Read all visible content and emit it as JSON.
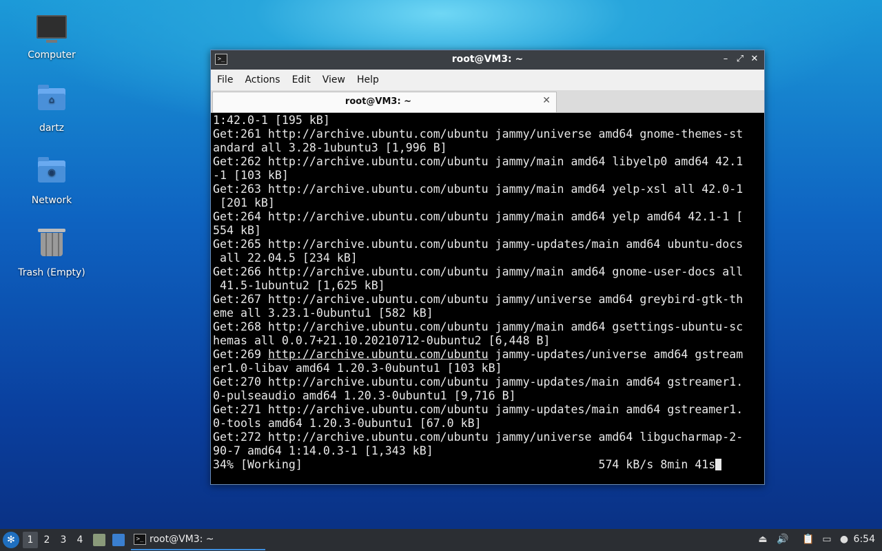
{
  "desktop": {
    "icons": [
      {
        "label": "Computer",
        "icon": "computer-icon"
      },
      {
        "label": "dartz",
        "icon": "home-folder-icon"
      },
      {
        "label": "Network",
        "icon": "network-folder-icon"
      },
      {
        "label": "Trash (Empty)",
        "icon": "trash-icon"
      }
    ]
  },
  "window": {
    "title": "root@VM3: ~",
    "controls": {
      "minimize": "–",
      "maximize": "⤢",
      "close": "✕"
    },
    "menu": [
      "File",
      "Actions",
      "Edit",
      "View",
      "Help"
    ],
    "tab": {
      "label": "root@VM3: ~",
      "close": "✕"
    }
  },
  "terminal": {
    "lines": [
      "1:42.0-1 [195 kB]",
      "Get:261 http://archive.ubuntu.com/ubuntu jammy/universe amd64 gnome-themes-st",
      "andard all 3.28-1ubuntu3 [1,996 B]",
      "Get:262 http://archive.ubuntu.com/ubuntu jammy/main amd64 libyelp0 amd64 42.1",
      "-1 [103 kB]",
      "Get:263 http://archive.ubuntu.com/ubuntu jammy/main amd64 yelp-xsl all 42.0-1",
      " [201 kB]",
      "Get:264 http://archive.ubuntu.com/ubuntu jammy/main amd64 yelp amd64 42.1-1 [",
      "554 kB]",
      "Get:265 http://archive.ubuntu.com/ubuntu jammy-updates/main amd64 ubuntu-docs",
      " all 22.04.5 [234 kB]",
      "Get:266 http://archive.ubuntu.com/ubuntu jammy/main amd64 gnome-user-docs all",
      " 41.5-1ubuntu2 [1,625 kB]",
      "Get:267 http://archive.ubuntu.com/ubuntu jammy/universe amd64 greybird-gtk-th",
      "eme all 3.23.1-0ubuntu1 [582 kB]",
      "Get:268 http://archive.ubuntu.com/ubuntu jammy/main amd64 gsettings-ubuntu-sc",
      "hemas all 0.0.7+21.10.20210712-0ubuntu2 [6,448 B]",
      "Get:269 http://archive.ubuntu.com/ubuntu jammy-updates/universe amd64 gstream",
      "er1.0-libav amd64 1.20.3-0ubuntu1 [103 kB]",
      "Get:270 http://archive.ubuntu.com/ubuntu jammy-updates/main amd64 gstreamer1.",
      "0-pulseaudio amd64 1.20.3-0ubuntu1 [9,716 B]",
      "Get:271 http://archive.ubuntu.com/ubuntu jammy-updates/main amd64 gstreamer1.",
      "0-tools amd64 1.20.3-0ubuntu1 [67.0 kB]",
      "Get:272 http://archive.ubuntu.com/ubuntu jammy/universe amd64 libgucharmap-2-",
      "90-7 amd64 1:14.0.3-1 [1,343 kB]"
    ],
    "status_line": "34% [Working]                                           574 kB/s 8min 41s"
  },
  "taskbar": {
    "workspaces": [
      "1",
      "2",
      "3",
      "4"
    ],
    "active_workspace": "1",
    "task_label": "root@VM3: ~",
    "clock": "6:54"
  },
  "colors": {
    "terminal_bg": "#000000",
    "terminal_fg": "#e8e8e8",
    "titlebar": "#3b3f44",
    "taskbar": "#2b2e33",
    "accent": "#3d8fe0"
  }
}
